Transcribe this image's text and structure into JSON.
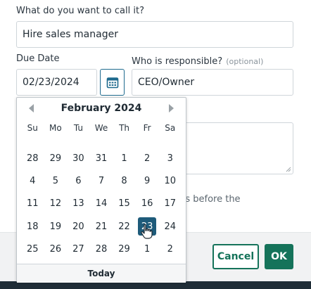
{
  "form": {
    "name_label": "What do you want to call it?",
    "name_value": "Hire sales manager",
    "due_label": "Due Date",
    "due_value": "02/23/2024",
    "resp_label": "Who is responsible?",
    "resp_optional": "(optional)",
    "resp_value": "CEO/Owner",
    "reminder_fragment": "rs before the"
  },
  "datepicker": {
    "month_title": "February 2024",
    "weekdays": [
      "Su",
      "Mo",
      "Tu",
      "We",
      "Th",
      "Fr",
      "Sa"
    ],
    "days": [
      "28",
      "29",
      "30",
      "31",
      "1",
      "2",
      "3",
      "4",
      "5",
      "6",
      "7",
      "8",
      "9",
      "10",
      "11",
      "12",
      "13",
      "14",
      "15",
      "16",
      "17",
      "18",
      "19",
      "20",
      "21",
      "22",
      "23",
      "24",
      "25",
      "26",
      "27",
      "28",
      "29",
      "1",
      "2"
    ],
    "selected_day": "23",
    "today_label": "Today"
  },
  "buttons": {
    "cancel_label": "Cancel",
    "ok_label": "OK"
  },
  "colors": {
    "accent_green": "#15735a",
    "selected_blue": "#1e5b7a",
    "calendar_icon": "#1e6a8e"
  },
  "icons": {
    "calendar": "calendar-icon",
    "cursor": "hand-pointer-icon"
  }
}
